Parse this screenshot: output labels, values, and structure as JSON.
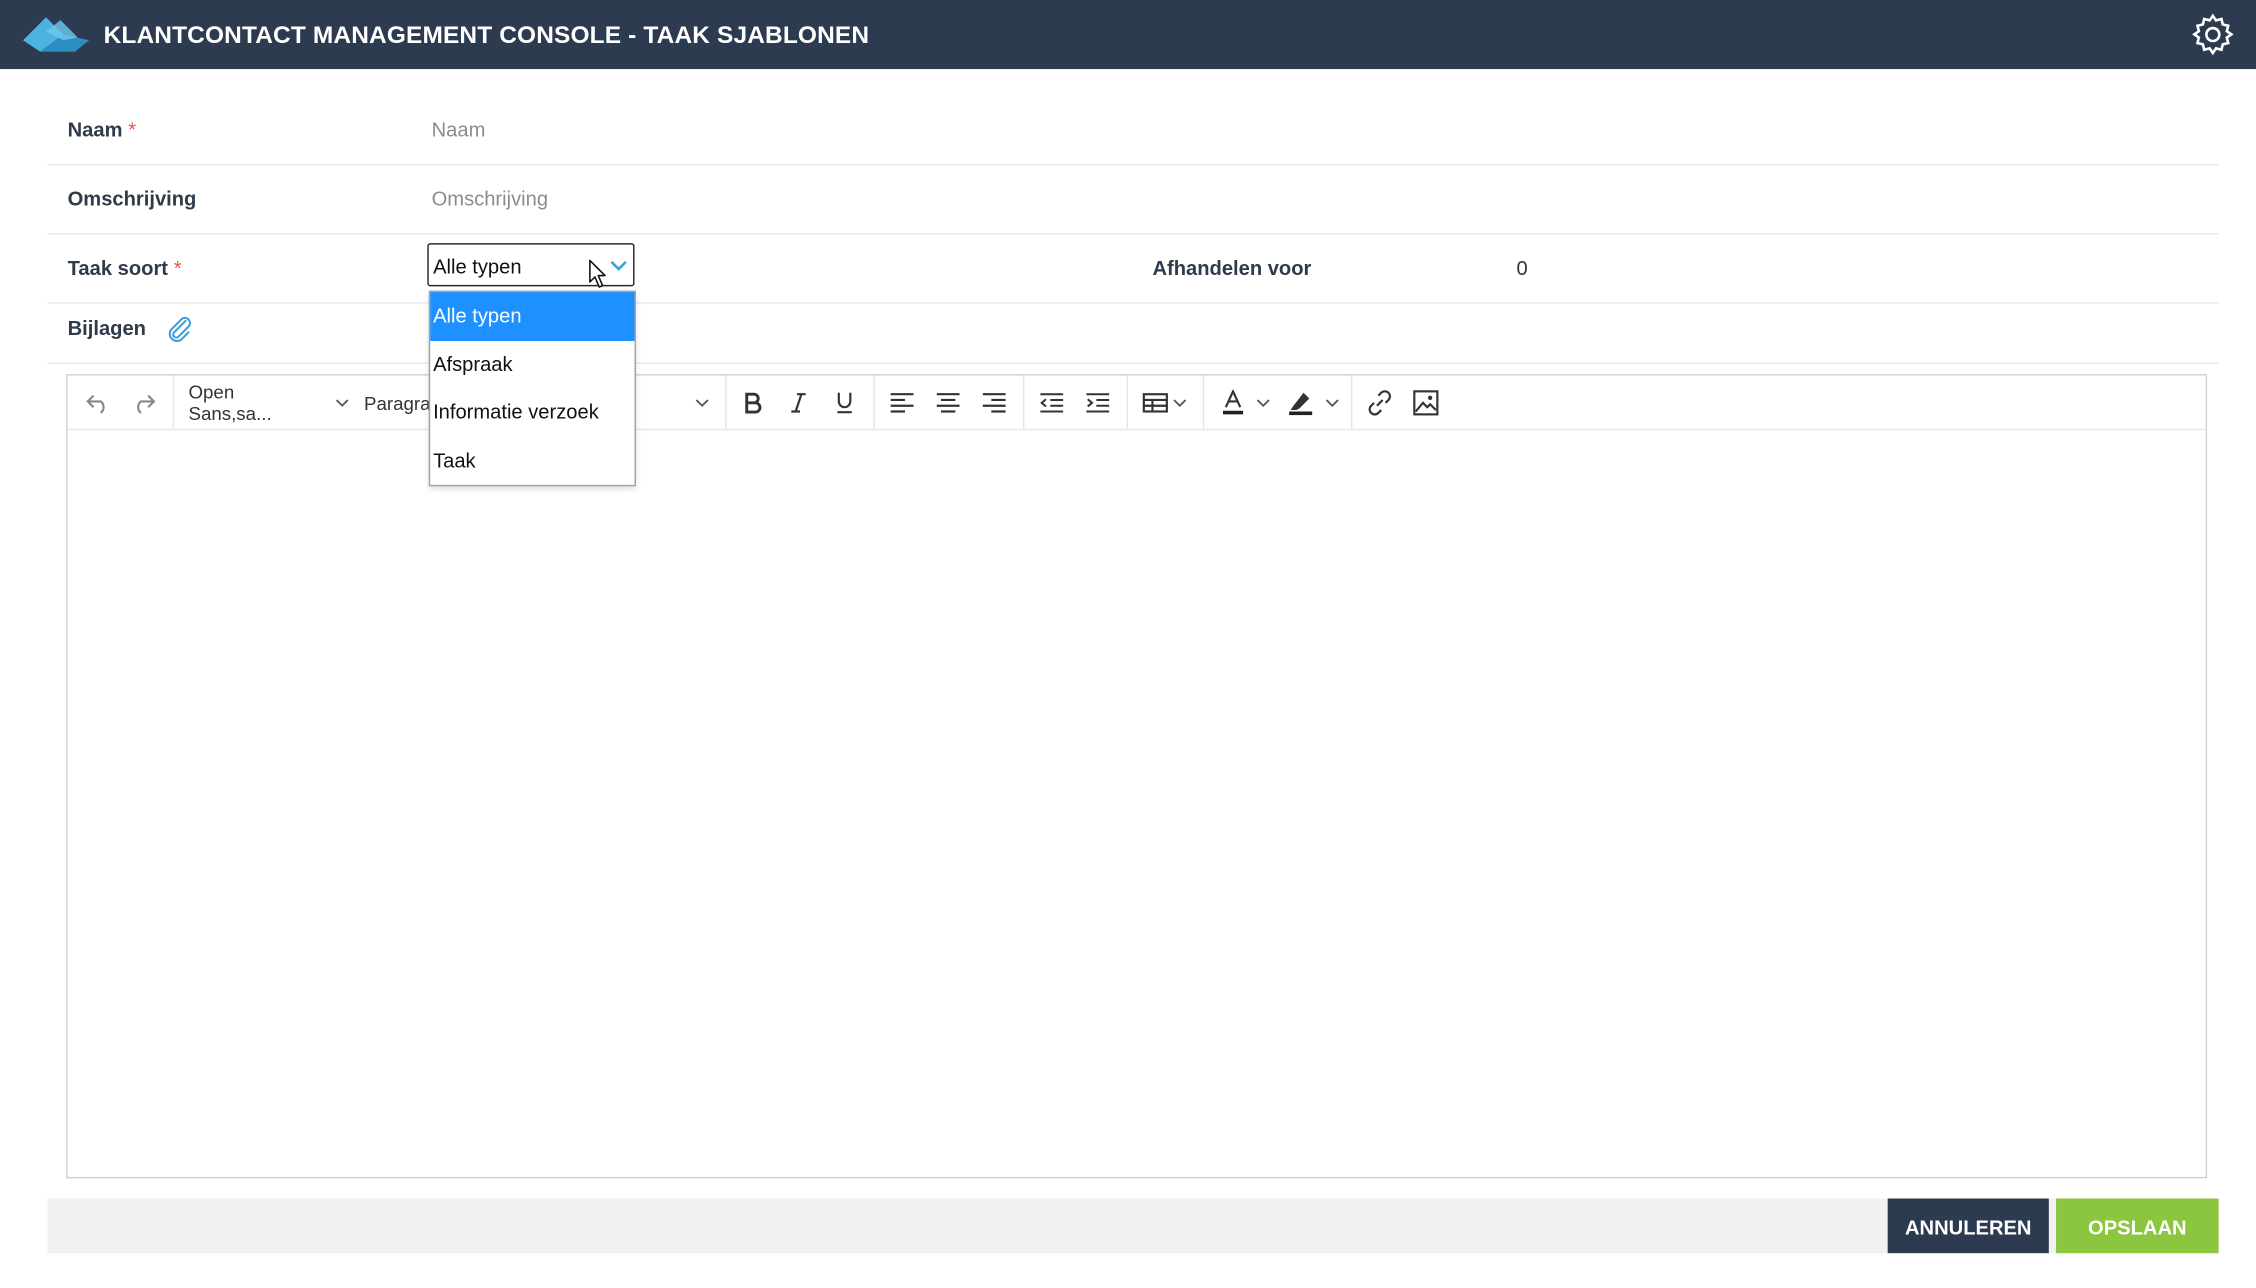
{
  "header": {
    "title": "KLANTCONTACT MANAGEMENT CONSOLE - TAAK SJABLONEN",
    "icon": "gear-icon"
  },
  "form": {
    "naam": {
      "label": "Naam",
      "required_mark": "*",
      "placeholder": "Naam",
      "value": ""
    },
    "omschrijving": {
      "label": "Omschrijving",
      "placeholder": "Omschrijving",
      "value": ""
    },
    "taak_soort": {
      "label": "Taak soort",
      "required_mark": "*",
      "selected": "Alle typen",
      "options": [
        "Alle typen",
        "Afspraak",
        "Informatie verzoek",
        "Taak"
      ],
      "open": true
    },
    "afhandelen_voor": {
      "label": "Afhandelen voor",
      "value": "0"
    },
    "bijlagen": {
      "label": "Bijlagen",
      "icon": "paperclip-icon"
    }
  },
  "editor": {
    "font_family": "Open Sans,sa...",
    "block_format": "Paragra",
    "buttons": [
      "undo",
      "redo",
      "bold",
      "italic",
      "underline",
      "align-left",
      "align-center",
      "align-right",
      "outdent",
      "indent",
      "table",
      "text-color",
      "highlight",
      "link",
      "image"
    ]
  },
  "footer": {
    "cancel_label": "ANNULEREN",
    "save_label": "OPSLAAN"
  },
  "colors": {
    "header_bg": "#2c3b50",
    "accent_blue": "#1e90ff",
    "save_green": "#8cc63f",
    "required_red": "#e2574c"
  }
}
